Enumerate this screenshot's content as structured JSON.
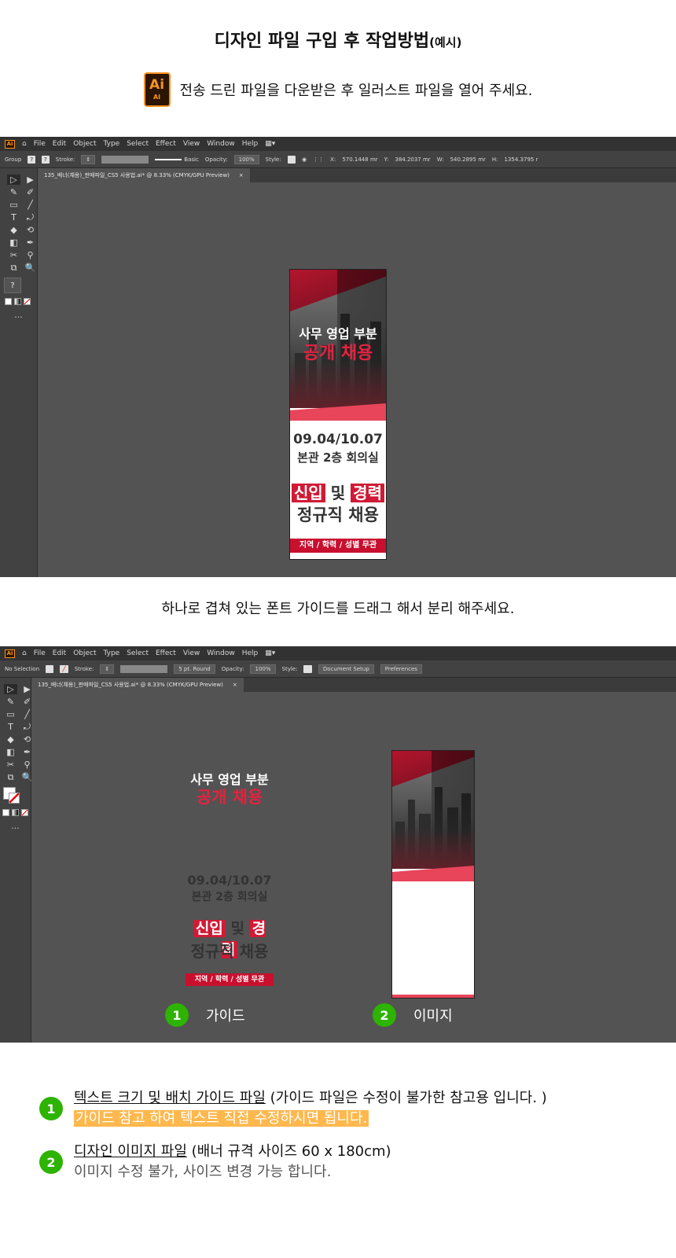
{
  "page": {
    "title": "디자인 파일 구입 후 작업방법",
    "title_suffix": "(예시)",
    "intro_text": "전송 드린 파일을 다운받은 후 일러스트 파일을 열어 주세요.",
    "ai_logo": "Ai",
    "ai_logo_sub": "AI",
    "mid_text": "하나로 겹쳐 있는 폰트 가이드를 드래그 해서 분리 해주세요."
  },
  "app": {
    "logo": "Ai",
    "menu": [
      "File",
      "Edit",
      "Object",
      "Type",
      "Select",
      "Effect",
      "View",
      "Window",
      "Help"
    ],
    "workspace_icon": "▦▾",
    "ctrl1": {
      "mode": "Group",
      "stroke_label": "Stroke:",
      "stroke_style": "Basic",
      "opacity_label": "Opacity:",
      "opacity_value": "100%",
      "style_label": "Style:",
      "x_label": "X:",
      "x_value": "570.1448 mr",
      "y_label": "Y:",
      "y_value": "384.2037 mr",
      "w_label": "W:",
      "w_value": "540.2895 mr",
      "h_label": "H:",
      "h_value": "1354.3795 r"
    },
    "ctrl2": {
      "mode": "No Selection",
      "stroke_label": "Stroke:",
      "stroke_style": "5 pt. Round",
      "opacity_label": "Opacity:",
      "opacity_value": "100%",
      "style_label": "Style:",
      "doc_setup": "Document Setup",
      "preferences": "Preferences"
    },
    "tab_name": "135_배너(채용)_판매파일_CS5 사용법.ai* @ 8.33% (CMYK/GPU Preview)",
    "tab_close": "×",
    "tools": [
      "▷",
      "▶",
      "✎",
      "✐",
      "▭",
      "╱",
      "T",
      "⤾",
      "◆",
      "⟲",
      "◧",
      "✒",
      "✂",
      "⚲",
      "⧉",
      "🔍"
    ],
    "color_box": "?",
    "more": "..."
  },
  "banner": {
    "line1": "사무 영업 부분",
    "line2": "공개 채용",
    "date": "09.04/10.07",
    "place": "본관 2층 회의실",
    "tag1": "신입",
    "and": "및",
    "tag2": "경력",
    "job": "정규직 채용",
    "footer": "지역 / 학력 / 성별 무관"
  },
  "labels": {
    "guide_num": "1",
    "guide": "가이드",
    "image_num": "2",
    "image": "이미지"
  },
  "notes": [
    {
      "num": "1",
      "title": "텍스트 크기 및 배치 가이드 파일",
      "desc": " (가이드 파일은 수정이 불가한 참고용 입니다. )",
      "sub": "가이드 참고 하여 텍스트 직접 수정하시면 됩니다."
    },
    {
      "num": "2",
      "title": "디자인 이미지 파일",
      "desc": " (배너 규격 사이즈 60 x 180cm)",
      "sub": "이미지 수정 불가, 사이즈 변경 가능 합니다."
    }
  ],
  "colors": {
    "brand_red": "#e3233f",
    "badge_green": "#2db300",
    "highlight": "#ffb84d",
    "app_bg": "#535353"
  }
}
